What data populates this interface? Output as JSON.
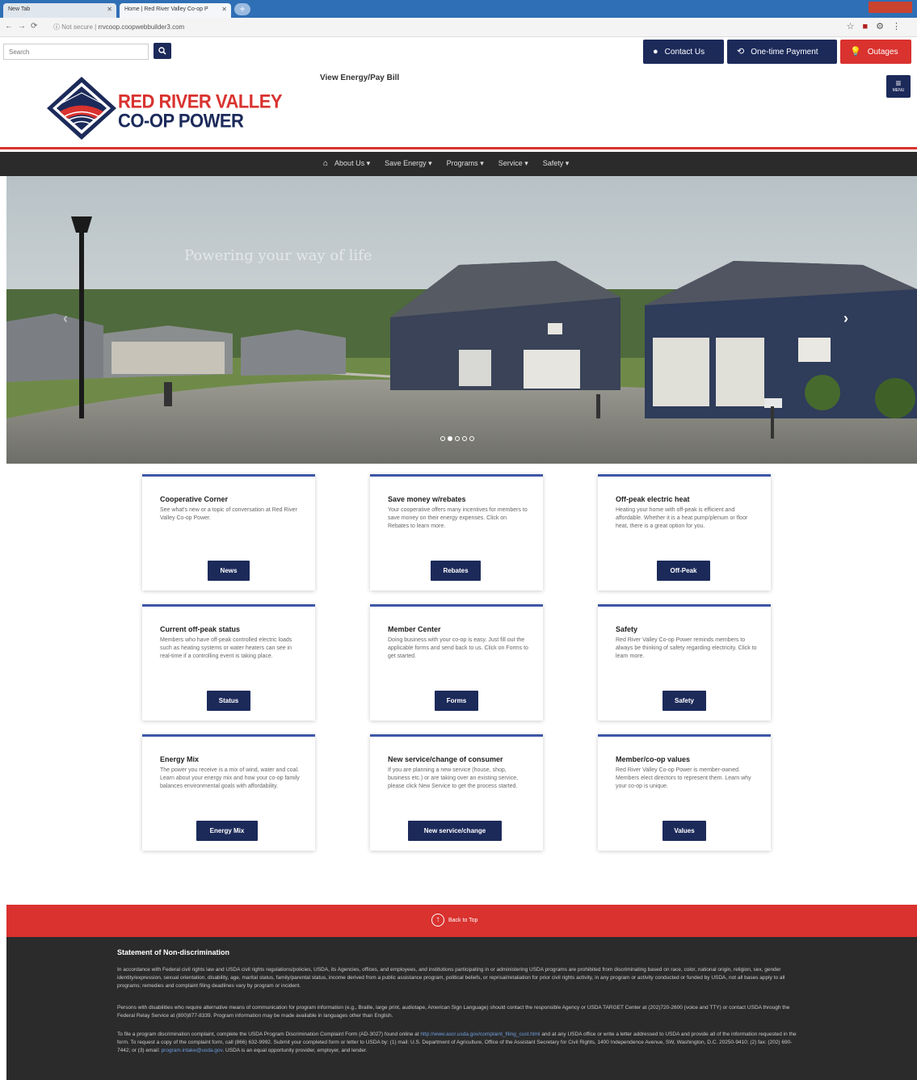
{
  "browser": {
    "tab1": "New Tab",
    "tab2": "Home | Red River Valley Co-op P",
    "url_prefix": "Not secure |",
    "url": "rrvcoop.coopwebbuilder3.com"
  },
  "utility": {
    "search_placeholder": "Search",
    "contact": "Contact Us",
    "payment": "One-time Payment",
    "outages": "Outages"
  },
  "header": {
    "brand_line1": "RED RIVER VALLEY",
    "brand_line2": "CO-OP POWER",
    "view_bill": "View Energy/Pay Bill",
    "menu_label": "MENU"
  },
  "nav": {
    "items": [
      "About Us",
      "Save Energy",
      "Programs",
      "Service",
      "Safety"
    ]
  },
  "hero": {
    "caption": "Powering your way of life",
    "slide_index": 2,
    "slide_count": 5
  },
  "cards": [
    {
      "title": "Cooperative Corner",
      "text": "See what's new or a topic of conversation at Red River Valley Co-op Power.",
      "button": "News"
    },
    {
      "title": "Save money w/rebates",
      "text": "Your cooperative offers many incentives for members to save money on their energy expenses. Click on Rebates to learn more.",
      "button": "Rebates"
    },
    {
      "title": "Off-peak electric heat",
      "text": "Heating your home with off-peak is efficient and affordable. Whether it is a heat pump/plenum or floor heat, there is a great option for you.",
      "button": "Off-Peak"
    },
    {
      "title": "Current off-peak status",
      "text": "Members who have off-peak controlled electric loads such as heating systems or water heaters can see in real-time if a controlling event is taking place.",
      "button": "Status"
    },
    {
      "title": "Member Center",
      "text": "Doing business with your co-op is easy. Just fill out the applicable forms and send back to us. Click on Forms to get started.",
      "button": "Forms"
    },
    {
      "title": "Safety",
      "text": "Red River Valley Co-op Power reminds members to always be thinking of safety regarding electricity. Click to learn more.",
      "button": "Safety"
    },
    {
      "title": "Energy Mix",
      "text": "The power you receive is a mix of wind, water and coal. Learn about your energy mix and how your co-op family balances environmental goals with affordability.",
      "button": "Energy Mix"
    },
    {
      "title": "New service/change of consumer",
      "text": "If you are planning a new service (house, shop, business etc.) or are taking over an existing service, please click New Service to get the process started.",
      "button": "New service/change"
    },
    {
      "title": "Member/co-op values",
      "text": "Red River Valley Co-op Power is member-owned. Members elect directors to represent them. Learn why your co-op is unique.",
      "button": "Values"
    }
  ],
  "back_to_top": "Back to Top",
  "footer": {
    "title": "Statement of Non-discrimination",
    "p1": "In accordance with Federal civil rights law and USDA civil rights regulations/policies, USDA, its Agencies, offices, and employees, and institutions participating in or administering USDA programs are prohibited from discriminating based on race, color, national origin, religion, sex, gender identity/expression, sexual orientation, disability, age, marital status, family/parental status, income derived from a public assistance program, political beliefs, or reprisal/retaliation for prior civil rights activity, in any program or activity conducted or funded by USDA, not all bases apply to all programs; remedies and complaint filing deadlines vary by program or incident.",
    "p2": "Persons with disabilities who require alternative means of communication for program information (e.g., Braille, large print, audiotape, American Sign Language) should contact the responsible Agency or USDA TARGET Center at (202)720-2600 (voice and TTY) or contact USDA through the Federal Relay Service at (800)877-8339. Program information may be made available in languages other than English.",
    "p3a": "To file a program discrimination complaint, complete the USDA Program Discrimination Complaint Form (AD-3027) found online at",
    "p3_link": "http://www.ascr.usda.gov/complaint_filing_cust.html",
    "p3b": "and at any USDA office or write a letter addressed to USDA and provide all of the information requested in the form. To request a copy of the complaint form, call (866) 632-9992. Submit your completed form or letter to USDA by: (1) mail: U.S. Department of Agriculture, Office of the Assistant Secretary for Civil Rights, 1400 Independence Avenue, SW, Washington, D.C. 20250-9410; (2) fax: (202) 690-7442; or (3) email:",
    "p3_email": "program.intake@usda.gov",
    "p3c": ". USDA is an equal opportunity provider, employer, and lender."
  },
  "colors": {
    "navy": "#1c2a5a",
    "red": "#d9322f",
    "card_accent": "#3e57a8",
    "dark": "#2b2b2b"
  }
}
